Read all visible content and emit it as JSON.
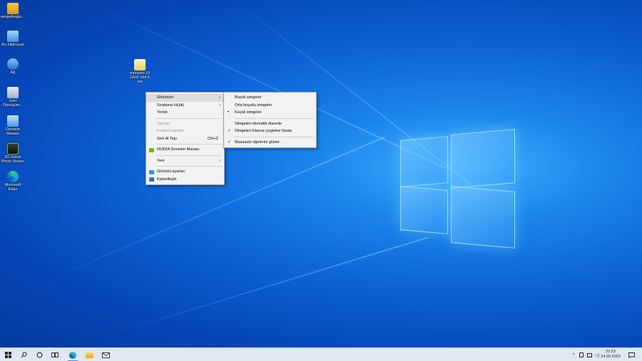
{
  "desktop_icons": [
    {
      "label": "wingetkeglo..."
    },
    {
      "label": "Bu bilgisayar"
    },
    {
      "label": "Ağ"
    },
    {
      "label": "Geri\nDönüşüm..."
    },
    {
      "label": "Denetim\nMasası"
    },
    {
      "label": "3D Vision\nPhoto Viewer"
    },
    {
      "label": "Microsoft\nEdge"
    },
    {
      "label": "windows 10\n22H2 x64 tr\niso"
    }
  ],
  "context_menu": {
    "items": [
      {
        "label": "Görünüm",
        "submenu": true
      },
      {
        "label": "Sıralama ölçütü",
        "submenu": true
      },
      {
        "label": "Yenile"
      },
      {
        "label": "Yapıştır",
        "disabled": true
      },
      {
        "label": "Kısayol yapıştır",
        "disabled": true
      },
      {
        "label": "Geri Al Taşı",
        "shortcut": "Ctrl+Z"
      },
      {
        "label": "NVIDIA Denetim Masası",
        "icon": "nvidia-icon"
      },
      {
        "label": "Yeni",
        "submenu": true
      },
      {
        "label": "Görüntü ayarları",
        "icon": "display-icon"
      },
      {
        "label": "Kişiselleştir",
        "icon": "personalize-icon"
      }
    ]
  },
  "view_submenu": {
    "items": [
      {
        "label": "Büyük simgeler"
      },
      {
        "label": "Orta boyutlu simgeler"
      },
      {
        "label": "Küçük simgeler",
        "mark": "•"
      },
      {
        "label": "Simgeleri otomatik düzenle"
      },
      {
        "label": "Simgeleri kılavuz çizgisine hizala",
        "mark": "✓"
      },
      {
        "label": "Masaüstü öğelerini göster",
        "mark": "✓"
      }
    ]
  },
  "taskbar": {
    "start": "start-icon",
    "search": "search-icon",
    "cortana": "cortana-icon",
    "task_view": "task-view-icon",
    "pinned": [
      "edge-icon",
      "file-explorer-icon",
      "mail-icon"
    ],
    "clock_time": "22:53",
    "clock_date": "24.02.2023"
  },
  "colors": {
    "accent": "#4a90e2",
    "menu_bg": "#f2f2f2",
    "taskbar_bg": "#dfe8f3"
  }
}
